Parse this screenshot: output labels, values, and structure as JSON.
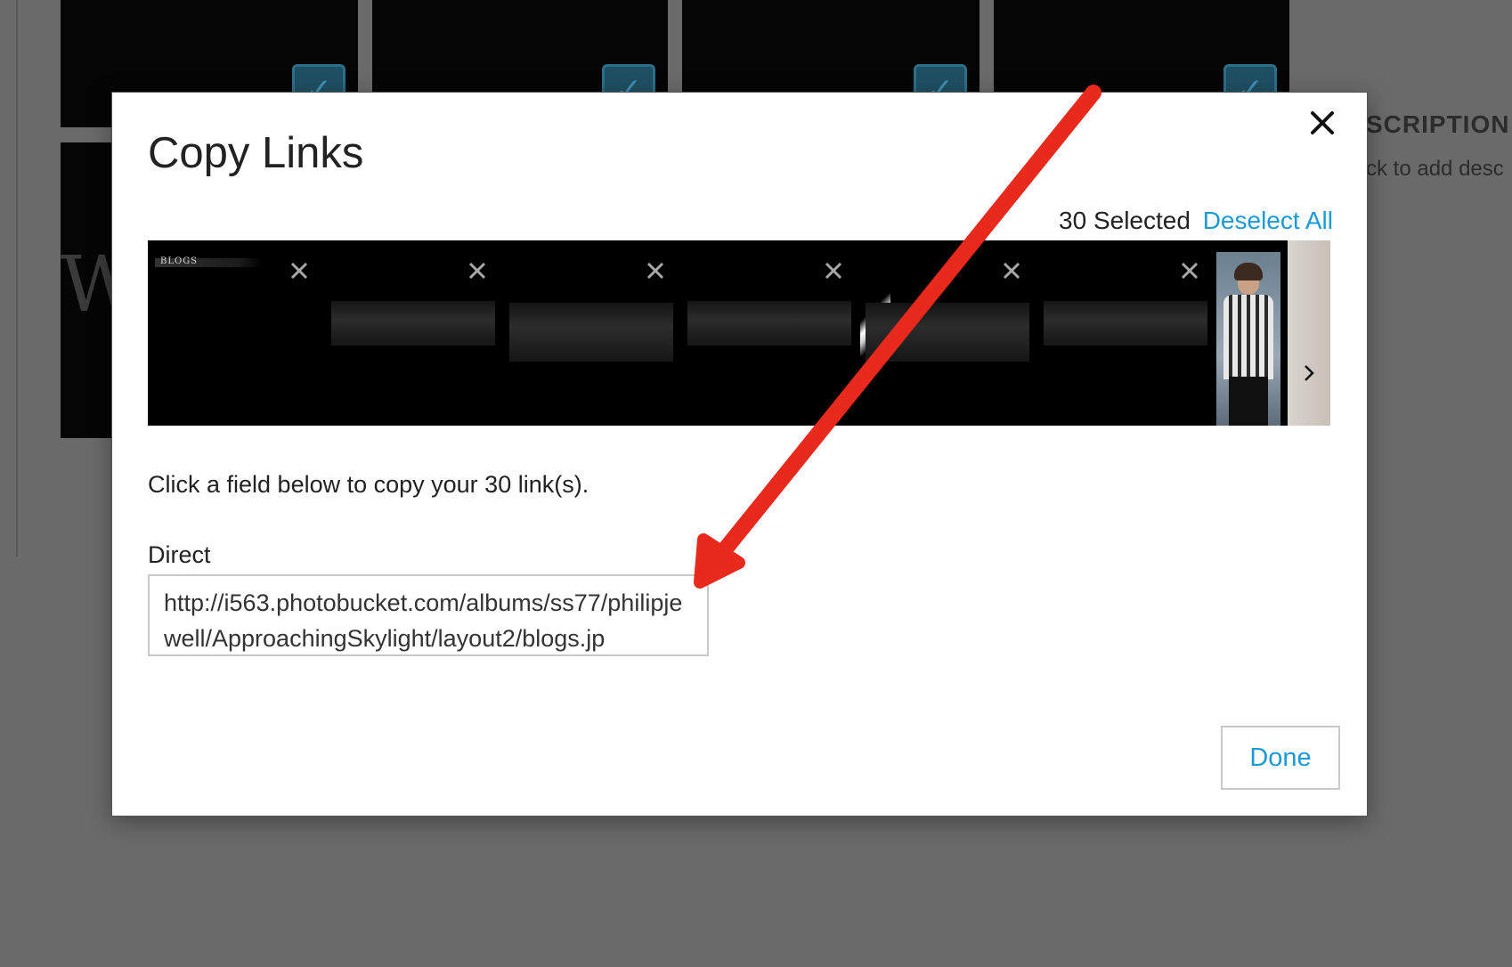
{
  "background": {
    "description_heading": "SCRIPTION",
    "description_hint": "ck to add desc"
  },
  "modal": {
    "title": "Copy Links",
    "close_icon": "close-icon",
    "selected_count": "30 Selected",
    "deselect_all_label": "Deselect All",
    "thumbnails": [
      {
        "name": "blogs",
        "label": "BLOGS"
      },
      {
        "name": "layout-bar-2"
      },
      {
        "name": "layout-bar-3"
      },
      {
        "name": "layout-bar-4"
      },
      {
        "name": "layout-bar-5"
      },
      {
        "name": "layout-bar-6"
      }
    ],
    "next_icon": "chevron-right-icon",
    "instructions": "Click a field below to copy your 30 link(s).",
    "direct_label": "Direct",
    "direct_value": "http://i563.photobucket.com/albums/ss77/philipjewell/ApproachingSkylight/layout2/blogs.jp",
    "done_label": "Done"
  },
  "colors": {
    "accent": "#1b9ad6",
    "annotation_arrow": "#e8291c",
    "overlay": "#6a6a6a"
  }
}
